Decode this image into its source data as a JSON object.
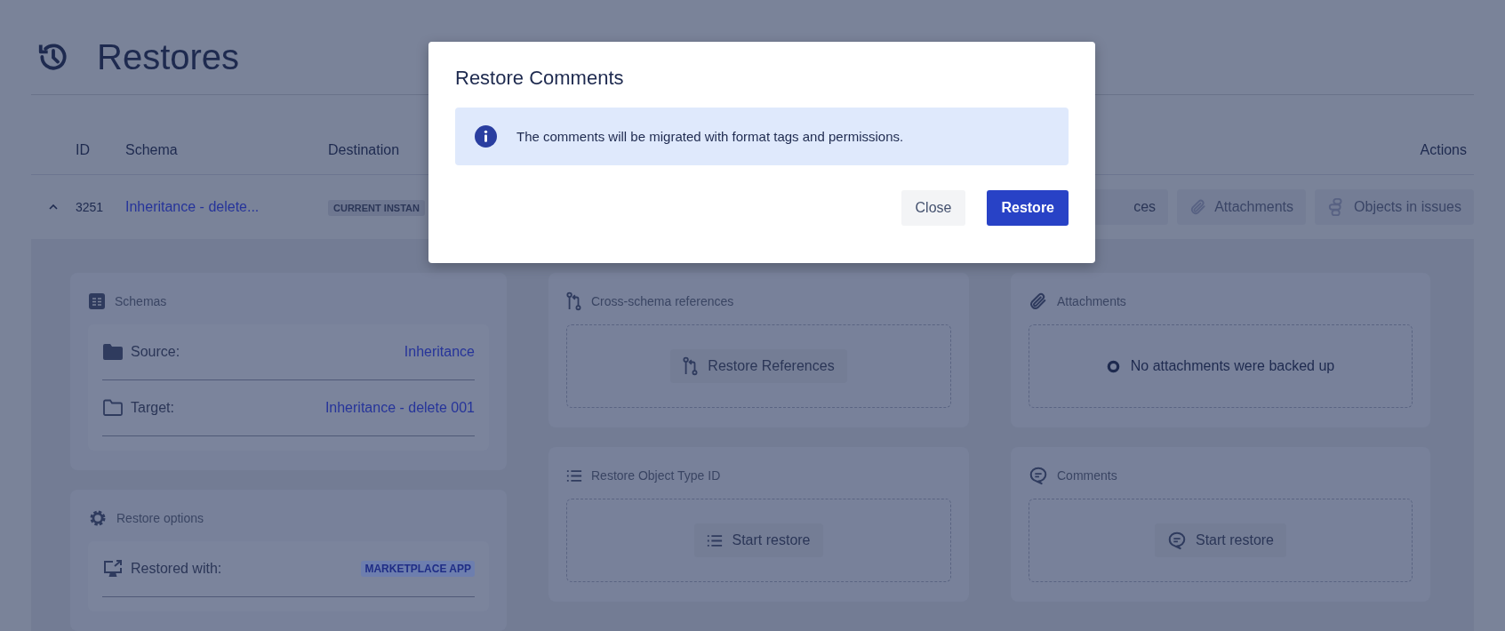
{
  "page": {
    "title": "Restores"
  },
  "table": {
    "columns": [
      {
        "label": "ID"
      },
      {
        "label": "Schema"
      },
      {
        "label": "Destination"
      },
      {
        "label": "Actions"
      }
    ],
    "rows": [
      {
        "expanded": true,
        "id": "3251",
        "schema": "Inheritance - delete...",
        "destination": "CURRENT INSTAN",
        "actions": [
          "ces",
          "Attachments",
          "Objects in issues"
        ],
        "details": [
          [
            {
              "kind": "list",
              "title": "Schemas",
              "rows": [
                {
                  "label": "Source:",
                  "value": "Inheritance"
                },
                {
                  "label": "Target:",
                  "value": "Inheritance - delete 001"
                }
              ]
            },
            {
              "kind": "list",
              "title": "Restore options",
              "rows": [
                {
                  "label": "Restored with:",
                  "badge": "MARKETPLACE APP"
                }
              ]
            }
          ],
          [
            {
              "kind": "action",
              "title": "Cross-schema references",
              "button": "Restore References"
            },
            {
              "kind": "action",
              "title": "Restore Object Type ID",
              "button": "Start restore"
            }
          ],
          [
            {
              "kind": "empty",
              "title": "Attachments",
              "message": "No attachments were backed up"
            },
            {
              "kind": "action",
              "title": "Comments",
              "button": "Start restore"
            }
          ]
        ]
      }
    ]
  },
  "modal": {
    "title": "Restore Comments",
    "info": "The comments will be migrated with format tags and permissions.",
    "buttons": [
      {
        "label": "Close",
        "kind": "secondary"
      },
      {
        "label": "Restore",
        "kind": "primary"
      }
    ]
  }
}
